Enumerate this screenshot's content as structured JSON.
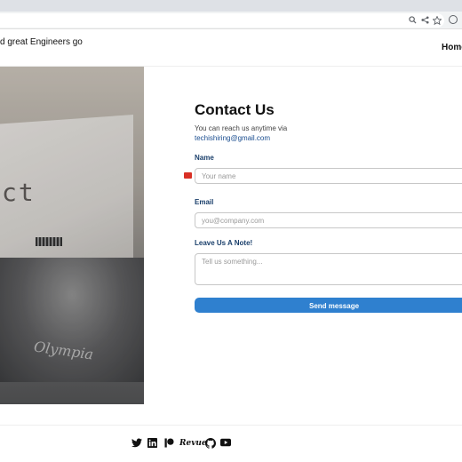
{
  "header": {
    "tagline": "d great Engineers go",
    "nav_home": "Home"
  },
  "hero": {
    "paper_text": "ct",
    "brand_script": "Olympia"
  },
  "contact": {
    "title": "Contact Us",
    "reach_text": "You can reach us anytime via",
    "email": "techishiring@gmail.com",
    "name_label": "Name",
    "name_placeholder": "Your name",
    "email_label": "Email",
    "email_placeholder": "you@company.com",
    "note_label": "Leave Us A Note!",
    "note_placeholder": "Tell us something...",
    "send_label": "Send message"
  },
  "footer": {
    "social_icons": [
      "twitter-icon",
      "linkedin-icon",
      "patreon-icon",
      "revue-icon",
      "github-icon",
      "youtube-icon"
    ],
    "revue_label": "Revue"
  },
  "colors": {
    "accent": "#2f80cf",
    "label": "#1a3f6b",
    "link": "#1a4d8f"
  }
}
